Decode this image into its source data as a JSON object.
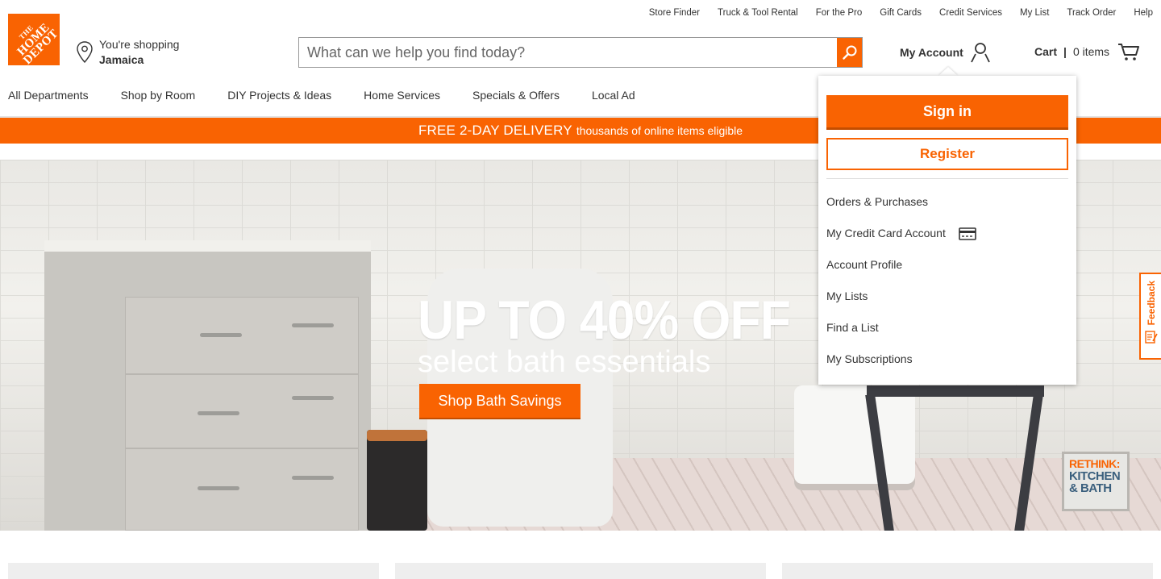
{
  "utility_nav": [
    "Store Finder",
    "Truck & Tool Rental",
    "For the Pro",
    "Gift Cards",
    "Credit Services",
    "My List",
    "Track Order",
    "Help"
  ],
  "logo": {
    "line1": "THE",
    "line2": "HOME",
    "line3": "DEPOT"
  },
  "location": {
    "prefix": "You're shopping",
    "store": "Jamaica"
  },
  "search": {
    "placeholder": "What can we help you find today?"
  },
  "account": {
    "label": "My Account"
  },
  "cart": {
    "label": "Cart",
    "separator": "|",
    "count": "0 items"
  },
  "main_nav": [
    "All Departments",
    "Shop by Room",
    "DIY Projects & Ideas",
    "Home Services",
    "Specials & Offers",
    "Local Ad"
  ],
  "banner": {
    "headline": "FREE 2-DAY DELIVERY",
    "subtext": "thousands of online items eligible"
  },
  "hero": {
    "headline": "UP TO 40% OFF",
    "subhead": "select bath essentials",
    "cta": "Shop Bath Savings",
    "badge_line1": "RETHINK:",
    "badge_line2": "KITCHEN",
    "badge_line3": "& BATH"
  },
  "feedback": {
    "label": "Feedback"
  },
  "account_dropdown": {
    "sign_in": "Sign in",
    "register": "Register",
    "items": [
      {
        "label": "Orders & Purchases",
        "icon": ""
      },
      {
        "label": "My Credit Card Account",
        "icon": "credit-card-icon"
      },
      {
        "label": "Account Profile",
        "icon": ""
      },
      {
        "label": "My Lists",
        "icon": ""
      },
      {
        "label": "Find a List",
        "icon": ""
      },
      {
        "label": "My Subscriptions",
        "icon": ""
      }
    ]
  },
  "colors": {
    "brand_orange": "#f96302",
    "text": "#333333"
  }
}
